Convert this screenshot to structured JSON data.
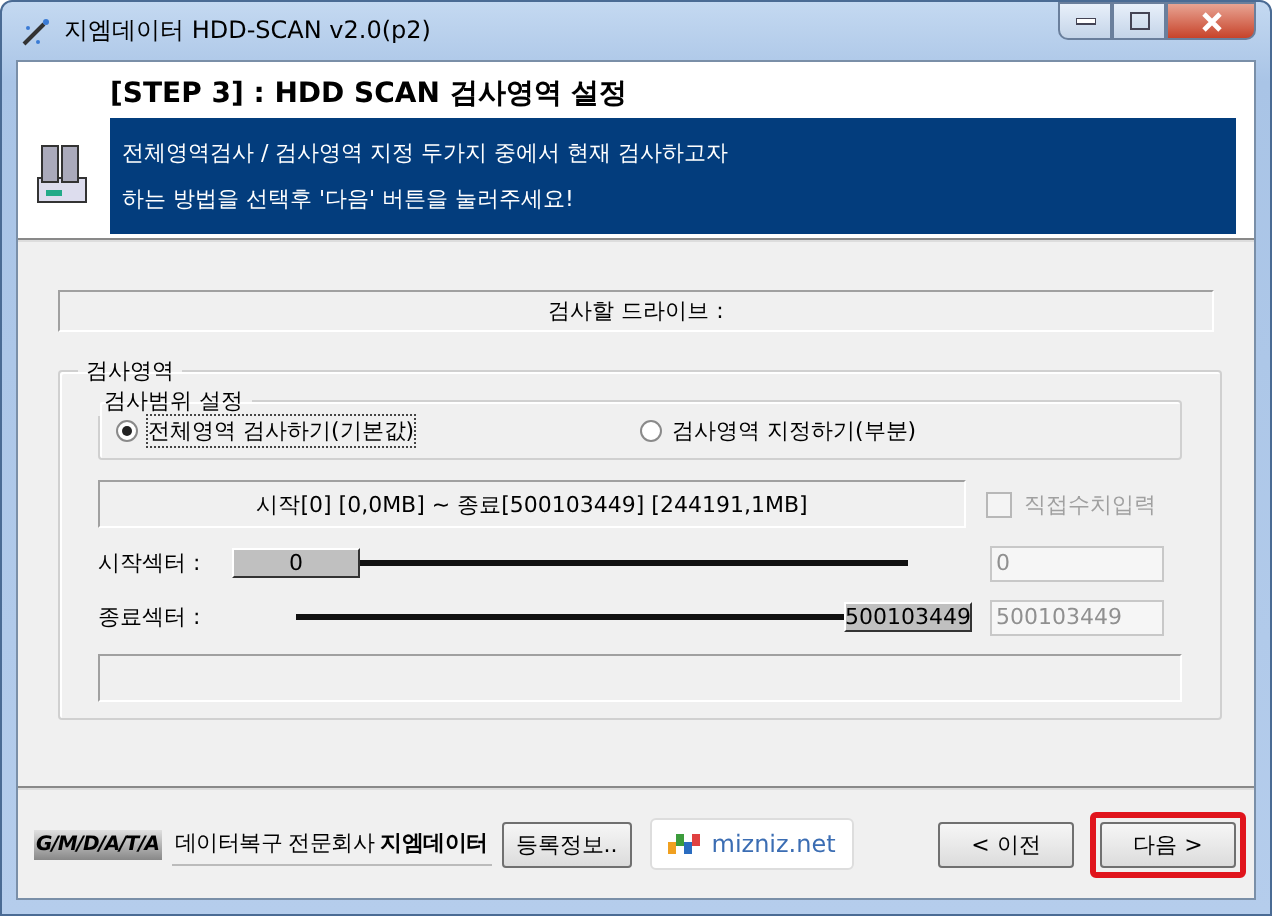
{
  "window": {
    "title": "지엠데이터 HDD-SCAN v2.0(p2)"
  },
  "header": {
    "title": "[STEP 3] : HDD SCAN 검사영역 설정",
    "lines": [
      "전체영역검사 / 검사영역 지정 두가지 중에서 현재 검사하고자",
      "하는 방법을 선택후 '다음' 버튼을 눌러주세요!"
    ]
  },
  "drive_label": "검사할 드라이브 :",
  "scan_area": {
    "title": "검사영역",
    "range_group": {
      "title": "검사범위 설정",
      "options": [
        {
          "label": "전체영역 검사하기(기본값)",
          "selected": true
        },
        {
          "label": "검사영역 지정하기(부분)",
          "selected": false
        }
      ]
    },
    "range_info": "시작[0] [0,0MB] ~ 종료[500103449] [244191,1MB]",
    "direct_input": {
      "label": "직접수치입력",
      "checked": false,
      "disabled": true
    },
    "sliders": [
      {
        "label": "시작섹터 :",
        "thumb": "0",
        "level": 0,
        "value": "0"
      },
      {
        "label": "종료섹터 :",
        "thumb": "500103449",
        "level": 1,
        "value": "500103449"
      }
    ]
  },
  "footer": {
    "logo": "G/M/D/A/T/A",
    "company": "데이터복구 전문회사 **지엠데이터**",
    "info_button": "등록정보..",
    "site": "mizniz.net",
    "buttons": [
      {
        "label": "< 이전",
        "highlighted": false
      },
      {
        "label": "다음 >",
        "highlighted": true
      }
    ]
  }
}
